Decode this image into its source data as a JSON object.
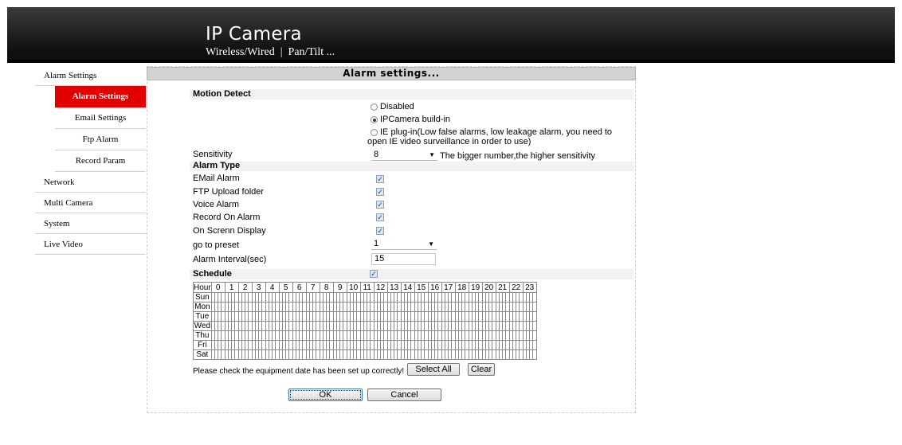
{
  "header": {
    "title": "IP Camera",
    "subtitle": "Wireless/Wired  |  Pan/Tilt ..."
  },
  "sidebar": {
    "group_label": "Alarm Settings",
    "sub_items": [
      "Alarm Settings",
      "Email Settings",
      "Ftp Alarm",
      "Record Param"
    ],
    "active_sub": "Alarm Settings",
    "items": [
      "Network",
      "Multi Camera",
      "System",
      "Live Video"
    ]
  },
  "panel": {
    "title": "Alarm settings..."
  },
  "motion": {
    "section": "Motion Detect",
    "options": [
      "Disabled",
      "IPCamera build-in",
      "IE plug-in(Low false alarms, low leakage alarm, you need to",
      "open IE video surveillance in order to use)"
    ],
    "selected": "IPCamera build-in",
    "sensitivity_label": "Sensitivity",
    "sensitivity_value": "8",
    "sensitivity_hint": "The bigger number,the higher sensitivity"
  },
  "alarm_type": {
    "section": "Alarm Type",
    "items": [
      {
        "label": "EMail Alarm",
        "checked": true
      },
      {
        "label": "FTP Upload folder",
        "checked": true
      },
      {
        "label": "Voice Alarm",
        "checked": true
      },
      {
        "label": "Record On Alarm",
        "checked": true
      },
      {
        "label": "On Screnn Display",
        "checked": true
      }
    ],
    "preset_label": "go to preset",
    "preset_value": "1",
    "interval_label": "Alarm Interval(sec)",
    "interval_value": "15"
  },
  "schedule": {
    "section": "Schedule",
    "checked": true,
    "hour_label": "Hour",
    "hours": [
      "0",
      "1",
      "2",
      "3",
      "4",
      "5",
      "6",
      "7",
      "8",
      "9",
      "10",
      "11",
      "12",
      "13",
      "14",
      "15",
      "16",
      "17",
      "18",
      "19",
      "20",
      "21",
      "22",
      "23"
    ],
    "days": [
      "Sun",
      "Mon",
      "Tue",
      "Wed",
      "Thu",
      "Fri",
      "Sat"
    ],
    "note": "Please check the equipment date has been set up correctly!",
    "select_all": "Select All",
    "clear": "Clear"
  },
  "buttons": {
    "ok": "OK",
    "cancel": "Cancel"
  },
  "icons": {
    "checkbox": "checkbox-checked-icon",
    "dropdown": "dropdown-arrow-icon",
    "radio": "radio-icon"
  }
}
